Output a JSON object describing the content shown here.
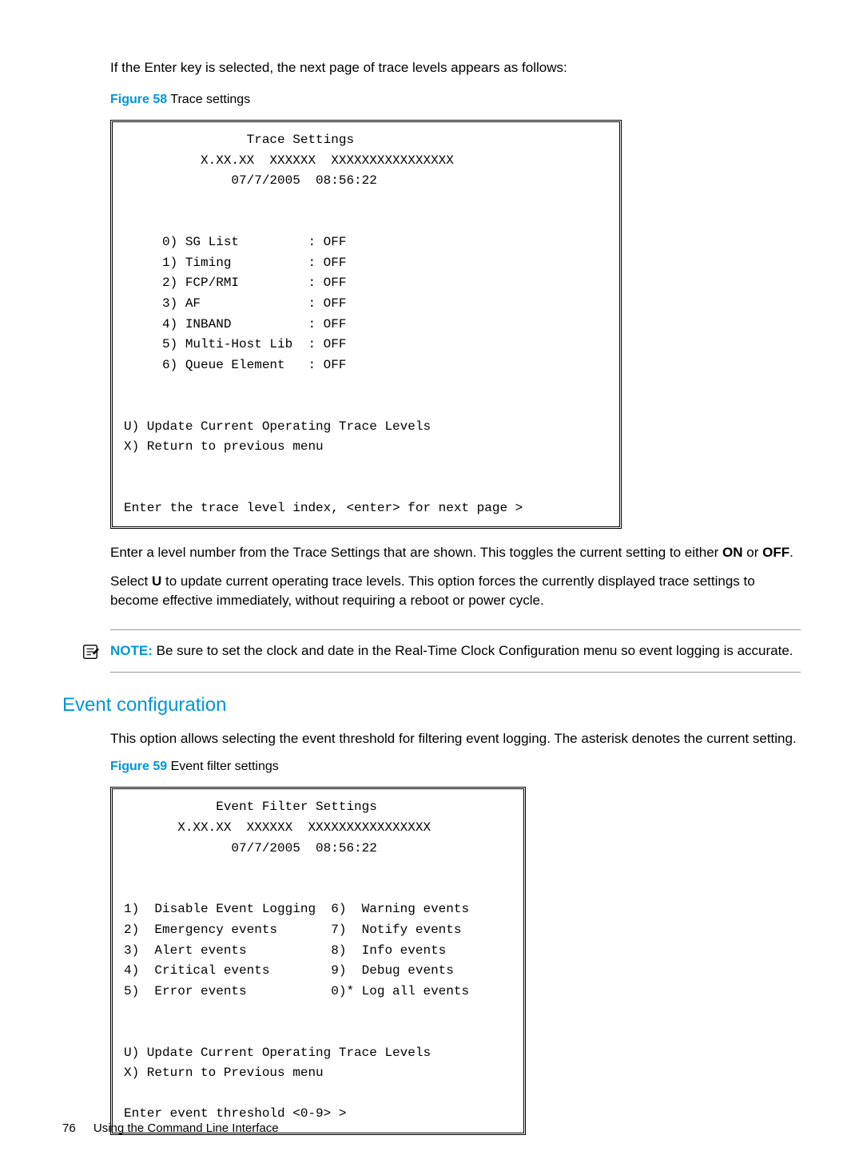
{
  "intro_line": "If the Enter key is selected, the next page of trace levels appears as follows:",
  "fig58": {
    "label": "Figure 58",
    "caption": "Trace settings"
  },
  "terminal1": "                Trace Settings\n          X.XX.XX  XXXXXX  XXXXXXXXXXXXXXXX\n              07/7/2005  08:56:22\n\n\n     0) SG List         : OFF\n     1) Timing          : OFF\n     2) FCP/RMI         : OFF\n     3) AF              : OFF\n     4) INBAND          : OFF\n     5) Multi-Host Lib  : OFF\n     6) Queue Element   : OFF\n\n\nU) Update Current Operating Trace Levels\nX) Return to previous menu\n\n\nEnter the trace level index, <enter> for next page >",
  "para_toggle_pre": "Enter a level number from the Trace Settings that are shown. This toggles the current setting to either ",
  "on_label": "ON",
  "para_toggle_mid": " or ",
  "off_label": "OFF",
  "para_toggle_post": ".",
  "para_update_pre": "Select ",
  "u_label": "U",
  "para_update_post": " to update current operating trace levels. This option forces the currently displayed trace settings to become effective immediately, without requiring a reboot or power cycle.",
  "note_label": "NOTE:",
  "note_text": "Be sure to set the clock and date in the Real-Time Clock Configuration menu so event logging is accurate.",
  "section_heading": "Event configuration",
  "event_intro": "This option allows selecting the event threshold for filtering event logging. The asterisk denotes the current setting.",
  "fig59": {
    "label": "Figure 59",
    "caption": "Event filter settings"
  },
  "terminal2": "            Event Filter Settings\n       X.XX.XX  XXXXXX  XXXXXXXXXXXXXXXX\n              07/7/2005  08:56:22\n\n\n1)  Disable Event Logging  6)  Warning events\n2)  Emergency events       7)  Notify events\n3)  Alert events           8)  Info events\n4)  Critical events        9)  Debug events\n5)  Error events           0)* Log all events\n\n\nU) Update Current Operating Trace Levels\nX) Return to Previous menu\n\nEnter event threshold <0-9> >",
  "footer": {
    "page_number": "76",
    "chapter": "Using the Command Line Interface"
  }
}
